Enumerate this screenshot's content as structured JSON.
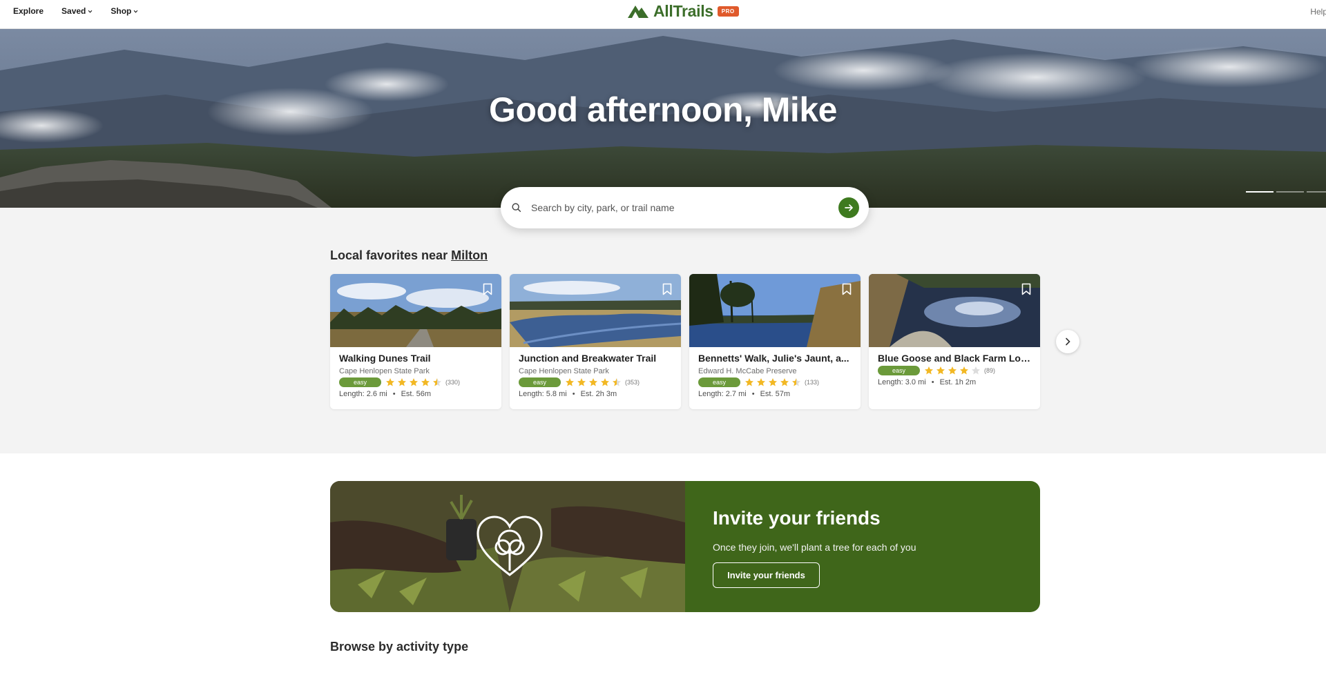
{
  "nav": {
    "items": [
      {
        "label": "Explore",
        "dropdown": false
      },
      {
        "label": "Saved",
        "dropdown": true
      },
      {
        "label": "Shop",
        "dropdown": true
      }
    ],
    "brand": "AllTrails",
    "badge": "PRO",
    "help": "Help"
  },
  "hero": {
    "greeting": "Good afternoon, Mike"
  },
  "search": {
    "placeholder": "Search by city, park, or trail name"
  },
  "favorites": {
    "heading": "Local favorites near",
    "location": "Milton",
    "cards": [
      {
        "name": "Walking Dunes Trail",
        "park": "Cape Henlopen State Park",
        "difficulty": "easy",
        "rating": 4.5,
        "reviews": "(330)",
        "length": "Length: 2.6 mi",
        "time": "Est. 56m"
      },
      {
        "name": "Junction and Breakwater Trail",
        "park": "Cape Henlopen State Park",
        "difficulty": "easy",
        "rating": 4.5,
        "reviews": "(353)",
        "length": "Length: 5.8 mi",
        "time": "Est. 2h 3m"
      },
      {
        "name": "Bennetts' Walk, Julie's Jaunt, a...",
        "park": "Edward H. McCabe Preserve",
        "difficulty": "easy",
        "rating": 4.5,
        "reviews": "(133)",
        "length": "Length: 2.7 mi",
        "time": "Est. 57m"
      },
      {
        "name": "Blue Goose and Black Farm Loop",
        "park": "",
        "difficulty": "easy",
        "rating": 4,
        "reviews": "(89)",
        "length": "Length: 3.0 mi",
        "time": "Est. 1h 2m"
      }
    ]
  },
  "invite": {
    "title": "Invite your friends",
    "subtitle": "Once they join, we'll plant a tree for each of you",
    "button": "Invite your friends"
  },
  "browse": {
    "heading": "Browse by activity type"
  },
  "colors": {
    "brand_green": "#3c6e2a",
    "go_button": "#3e7a1f",
    "easy_badge": "#6b9a3a",
    "invite_panel": "#3f661a",
    "pro_badge": "#e05a2b",
    "star": "#f2b824"
  }
}
